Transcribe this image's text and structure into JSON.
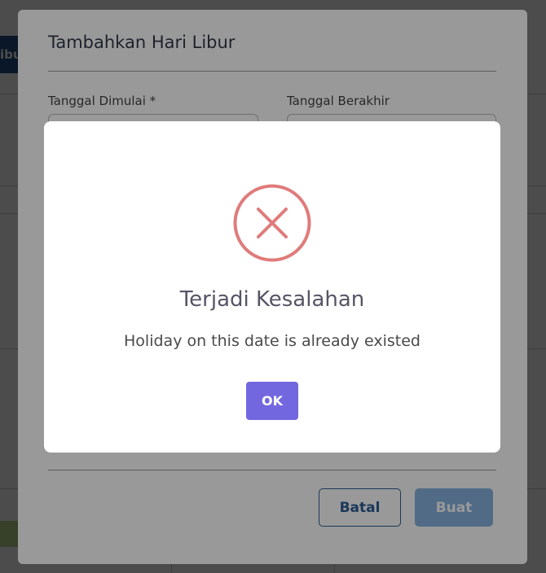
{
  "background": {
    "tab_label": "ibu"
  },
  "form": {
    "title": "Tambahkan Hari Libur",
    "start_date_label": "Tanggal Dimulai *",
    "end_date_label": "Tanggal Berakhir",
    "start_date_value": "",
    "end_date_value": "",
    "cancel_label": "Batal",
    "create_label": "Buat"
  },
  "alert": {
    "icon": "error-x-circle-icon",
    "title": "Terjadi Kesalahan",
    "message": "Holiday on this date is already existed",
    "ok_label": "OK"
  },
  "colors": {
    "error_icon": "#e07b7b",
    "ok_button": "#7367e0",
    "cancel_border": "#2d5c93",
    "create_button": "#88b2e2"
  }
}
